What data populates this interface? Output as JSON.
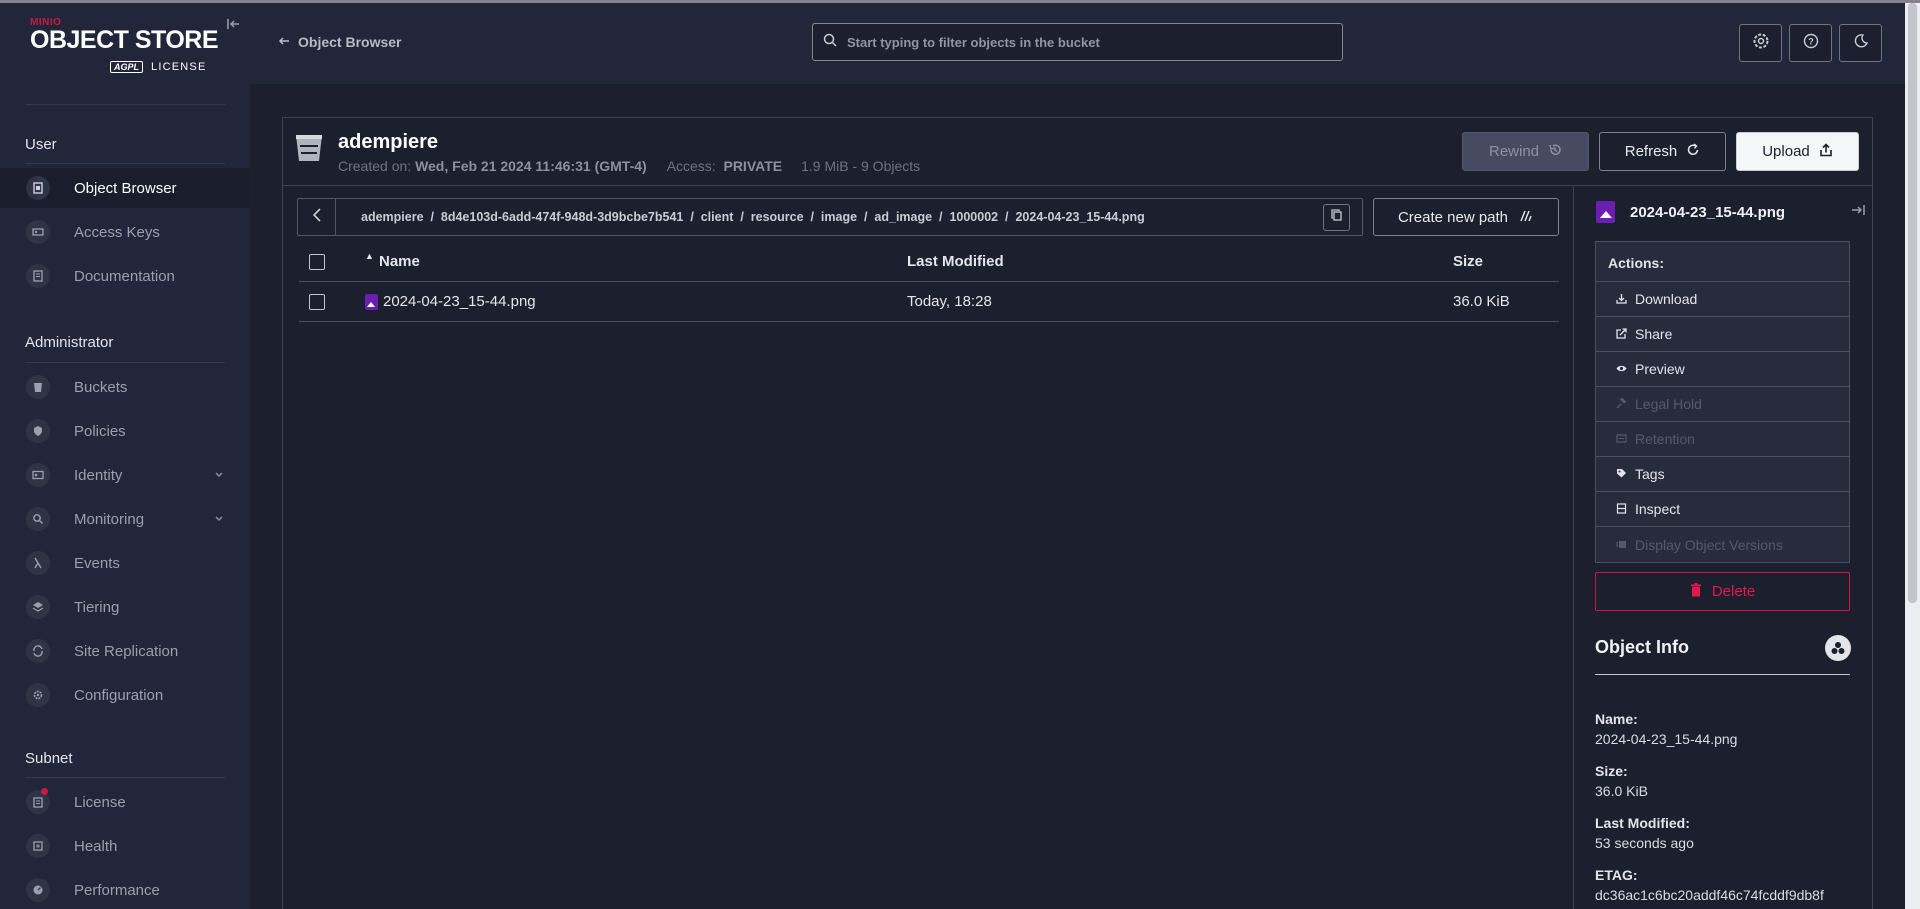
{
  "sidebar": {
    "logo": {
      "brand": "MINIO",
      "product": "OBJECT STORE",
      "license_badge": "AGPL",
      "license_label": "LICENSE"
    },
    "sections": {
      "user": "User",
      "admin": "Administrator",
      "subnet": "Subnet"
    },
    "items": {
      "object_browser": "Object Browser",
      "access_keys": "Access Keys",
      "documentation": "Documentation",
      "buckets": "Buckets",
      "policies": "Policies",
      "identity": "Identity",
      "monitoring": "Monitoring",
      "events": "Events",
      "tiering": "Tiering",
      "site_replication": "Site Replication",
      "configuration": "Configuration",
      "license": "License",
      "health": "Health",
      "performance": "Performance"
    }
  },
  "topbar": {
    "back_label": "Object Browser",
    "search_placeholder": "Start typing to filter objects in the bucket",
    "search_value": ""
  },
  "bucket": {
    "name": "adempiere",
    "created_label": "Created on:",
    "created_value": "Wed, Feb 21 2024 11:46:31 (GMT-4)",
    "access_label": "Access:",
    "access_value": "PRIVATE",
    "usage": "1.9 MiB - 9 Objects",
    "buttons": {
      "rewind": "Rewind",
      "refresh": "Refresh",
      "upload": "Upload"
    }
  },
  "breadcrumb": {
    "path": "adempiere  /  8d4e103d-6add-474f-948d-3d9bcbe7b541  /  client  /  resource  /  image  /  ad_image  /  1000002  /  2024-04-23_15-44.png",
    "create_path_label": "Create new path"
  },
  "table": {
    "headers": {
      "name": "Name",
      "modified": "Last Modified",
      "size": "Size"
    },
    "rows": [
      {
        "name": "2024-04-23_15-44.png",
        "modified": "Today, 18:28",
        "size": "36.0 KiB"
      }
    ]
  },
  "detail": {
    "file_name": "2024-04-23_15-44.png",
    "actions_title": "Actions:",
    "actions": {
      "download": "Download",
      "share": "Share",
      "preview": "Preview",
      "legal_hold": "Legal Hold",
      "retention": "Retention",
      "tags": "Tags",
      "inspect": "Inspect",
      "versions": "Display Object Versions"
    },
    "delete_label": "Delete",
    "object_info_title": "Object Info",
    "info": {
      "name_label": "Name:",
      "name_value": "2024-04-23_15-44.png",
      "size_label": "Size:",
      "size_value": "36.0 KiB",
      "modified_label": "Last Modified:",
      "modified_value": "53 seconds ago",
      "etag_label": "ETAG:",
      "etag_value": "dc36ac1c6bc20addf46c74fcddf9db8f"
    }
  },
  "colors": {
    "background": "#1c1f2e",
    "sidebar": "#22263a",
    "accent_danger": "#d4124a",
    "file_icon": "#6a1fb0"
  }
}
